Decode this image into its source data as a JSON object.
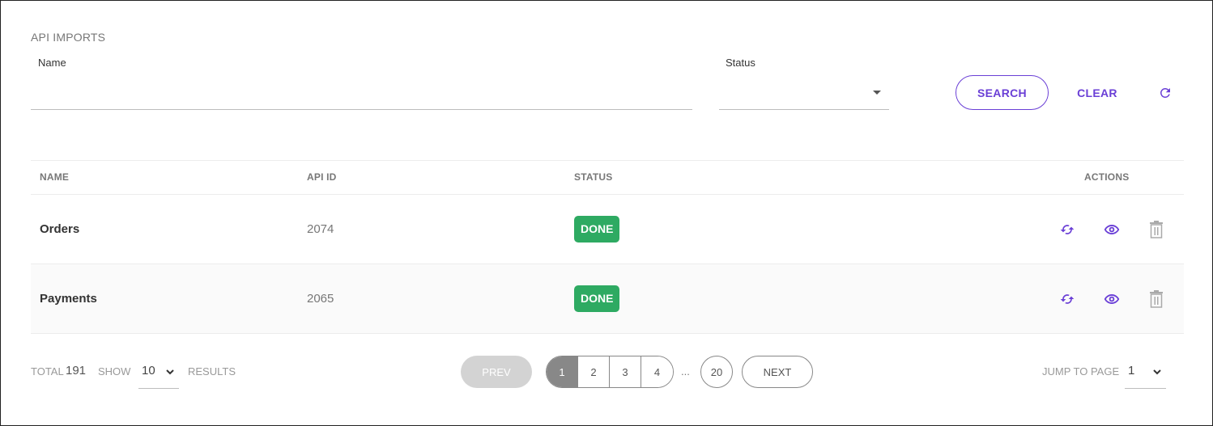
{
  "page": {
    "title": "API IMPORTS"
  },
  "filters": {
    "name_label": "Name",
    "name_value": "",
    "name_placeholder": "",
    "status_label": "Status",
    "status_value": "",
    "search_label": "SEARCH",
    "clear_label": "CLEAR",
    "refresh_icon": "refresh-icon"
  },
  "table": {
    "columns": [
      "NAME",
      "API ID",
      "STATUS",
      "ACTIONS"
    ],
    "rows": [
      {
        "name": "Orders",
        "api_id": "2074",
        "status": "DONE"
      },
      {
        "name": "Payments",
        "api_id": "2065",
        "status": "DONE"
      }
    ],
    "action_icons": [
      "sync-icon",
      "eye-icon",
      "trash-icon"
    ]
  },
  "colors": {
    "accent": "#6a3fd6",
    "status_done": "#2eaa62",
    "disabled": "#d3d3d3"
  },
  "footer": {
    "total_label": "TOTAL",
    "total_value": "191",
    "show_label": "SHOW",
    "show_value": "10",
    "results_label": "RESULTS",
    "jump_label": "JUMP TO PAGE",
    "jump_value": "1"
  },
  "pagination": {
    "prev_label": "PREV",
    "next_label": "NEXT",
    "pages": [
      "1",
      "2",
      "3",
      "4"
    ],
    "current": "1",
    "ellipsis": "...",
    "last_page": "20"
  }
}
